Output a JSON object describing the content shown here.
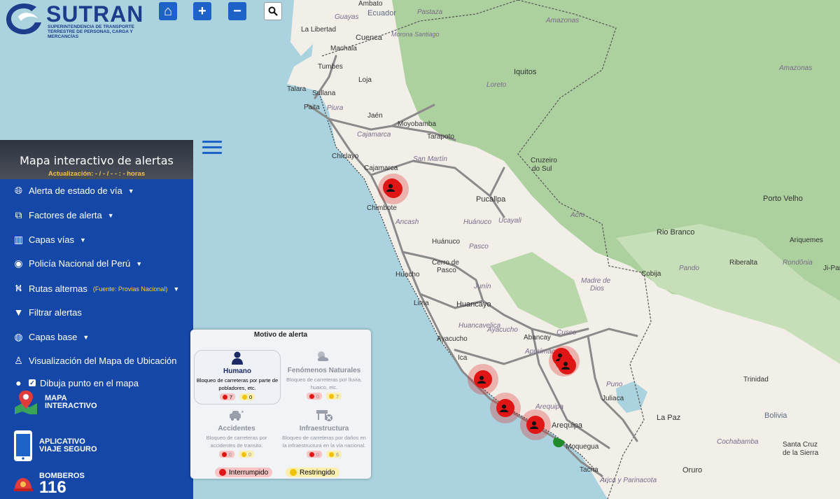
{
  "header": {
    "logo_name": "SUTRAN",
    "logo_subtitle": "SUPERINTENDENCIA DE TRANSPORTE TERRESTRE DE PERSONAS, CARGA Y MERCANCÍAS",
    "buttons": {
      "home": "⌂",
      "zoom_in": "+",
      "zoom_out": "−",
      "search": "⚲"
    }
  },
  "panel": {
    "title": "Mapa interactivo de alertas",
    "update": "Actualización: - / - / - - : - horas",
    "menu": [
      {
        "icon": "globe-icon",
        "label": "Alerta de estado de vía"
      },
      {
        "icon": "binoculars-icon",
        "label": "Factores de alerta"
      },
      {
        "icon": "map-icon",
        "label": "Capas vías"
      },
      {
        "icon": "eye-icon",
        "label": "Policía Nacional del Perú"
      },
      {
        "icon": "route-icon",
        "label": "Rutas alternas",
        "note": "(Fuente: Provias Nacional)"
      },
      {
        "icon": "filter-icon",
        "label": "Filtrar alertas"
      },
      {
        "icon": "globe-americas-icon",
        "label": "Capas base"
      },
      {
        "icon": "street-view-icon",
        "label": "Visualización del Mapa de Ubicación"
      },
      {
        "icon": "map-marker-icon",
        "label": "Dibuja punto en el mapa"
      }
    ],
    "promos": [
      {
        "line1": "MAPA",
        "line2": "INTERACTIVO"
      },
      {
        "line1": "APLICATIVO",
        "line2": "VIAJE SEGURO"
      },
      {
        "line1": "BOMBEROS",
        "line2": "116"
      }
    ]
  },
  "legend": {
    "title": "Motivo de alerta",
    "cells": [
      {
        "label": "Humano",
        "desc": "Bloqueo de carreteras por parte de pobladores, etc.",
        "red": "7",
        "yellow": "0"
      },
      {
        "label": "Fenómenos Naturales",
        "desc": "Bloqueo de carreteras por lluvia, huaico, etc.",
        "red": "0",
        "yellow": "7"
      },
      {
        "label": "Accidentes",
        "desc": "Bloqueo de carreteras por accidentes de transito.",
        "red": "0",
        "yellow": "0"
      },
      {
        "label": "Infraestructura",
        "desc": "Bloqueo de carreteras por daños en la infraestructura en la vía nacional.",
        "red": "0",
        "yellow": "6"
      }
    ],
    "status": {
      "interrupted": "Interrumpido",
      "restricted": "Restringido"
    }
  },
  "map": {
    "colors": {
      "sea": "#aad3df",
      "land": "#f2efe9",
      "forest": "#add19e",
      "road": "#8a8a8a",
      "alert": "#e01616",
      "ok": "#1e8a2a"
    },
    "places": [
      "Ambato",
      "Ecuador",
      "Pastaza",
      "La Libertad",
      "Guayas",
      "Cuenca",
      "Morona Santiago",
      "Amazonas",
      "Machala",
      "Tumbes",
      "Loja",
      "Iquitos",
      "Talara",
      "Sullana",
      "Paita",
      "Piura",
      "Loreto",
      "Jaén",
      "Moyobamba",
      "Tarapoto",
      "Cajamarca",
      "Chiclayo",
      "San Martín",
      "Cruzeiro do Sul",
      "Chimbote",
      "Pucallpa",
      "Acre",
      "Porto Velho",
      "Ancash",
      "Huánuco",
      "Ucayali",
      "Rio Branco",
      "Huánuco",
      "Pasco",
      "Cerro de Pasco",
      "Huacho",
      "Riberalta",
      "Pando",
      "Madre de Dios",
      "Cobija",
      "Lima",
      "Huancayo",
      "Junín",
      "Huancavelica",
      "Cusco",
      "Abancay",
      "Ayacucho",
      "Apurímac",
      "Ica",
      "Puno",
      "Juliaca",
      "Arequipa",
      "La Paz",
      "Trinidad",
      "Moquegua",
      "Bolivia",
      "Tacna",
      "Cochabamba",
      "Santa Cruz de la Sierra",
      "Oruro",
      "Arica y Parinacota",
      "Amazonas",
      "Rondônia",
      "Ariquemes",
      "Ji-Paraná"
    ]
  }
}
